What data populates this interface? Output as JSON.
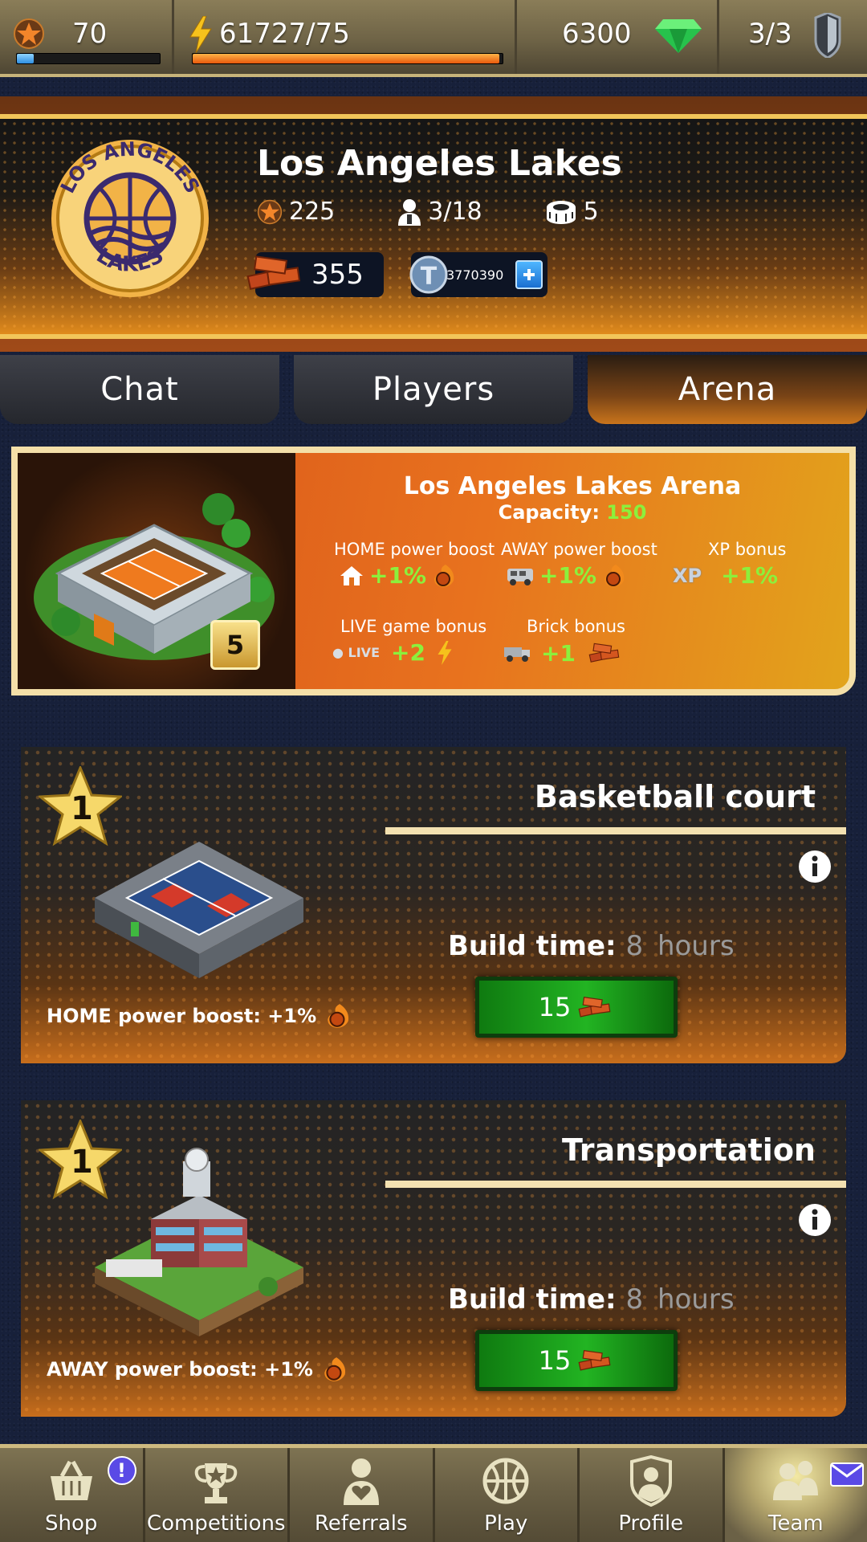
{
  "topbar": {
    "level": "70",
    "level_progress": 0.12,
    "energy": "61727/75",
    "energy_progress": 0.99,
    "gems": "6300",
    "shields": "3/3"
  },
  "team": {
    "name": "Los Angeles Lakes",
    "logo_top_text": "LOS ANGELES",
    "logo_bottom_text": "LAKES",
    "rating": "225",
    "players": "3/18",
    "arena_level": "5",
    "bricks": "355",
    "coins": "3770390"
  },
  "tabs": [
    {
      "label": "Chat",
      "active": false
    },
    {
      "label": "Players",
      "active": false
    },
    {
      "label": "Arena",
      "active": true
    }
  ],
  "arena": {
    "title": "Los Angeles Lakes Arena",
    "capacity_label": "Capacity:",
    "capacity_value": "150",
    "level": "5",
    "home_boost_label": "HOME power boost",
    "home_boost_value": "+1%",
    "away_boost_label": "AWAY power boost",
    "away_boost_value": "+1%",
    "xp_label": "XP bonus",
    "xp_icon_text": "XP",
    "xp_value": "+1%",
    "live_label": "LIVE game bonus",
    "live_icon_text": "LIVE",
    "live_value": "+2",
    "brick_label": "Brick bonus",
    "brick_value": "+1"
  },
  "buildings": [
    {
      "title": "Basketball court",
      "stars": "1",
      "build_time_label": "Build time:",
      "build_time_value": "8",
      "build_time_unit": "hours",
      "cost": "15",
      "boost_label": "HOME power boost: +1%"
    },
    {
      "title": "Transportation",
      "stars": "1",
      "build_time_label": "Build time:",
      "build_time_value": "8",
      "build_time_unit": "hours",
      "cost": "15",
      "boost_label": "AWAY power boost: +1%"
    }
  ],
  "nav": [
    {
      "label": "Shop",
      "icon": "basket-icon",
      "badge": "!"
    },
    {
      "label": "Competitions",
      "icon": "trophy-icon"
    },
    {
      "label": "Referrals",
      "icon": "person-heart-icon"
    },
    {
      "label": "Play",
      "icon": "basketball-icon"
    },
    {
      "label": "Profile",
      "icon": "shield-person-icon"
    },
    {
      "label": "Team",
      "icon": "team-icon",
      "active": true,
      "mail": true
    }
  ],
  "colors": {
    "accent_gold": "#f2c65a",
    "bonus_green": "#8cf03c",
    "build_green": "#22b422",
    "arena_orange": "#e8721e"
  }
}
